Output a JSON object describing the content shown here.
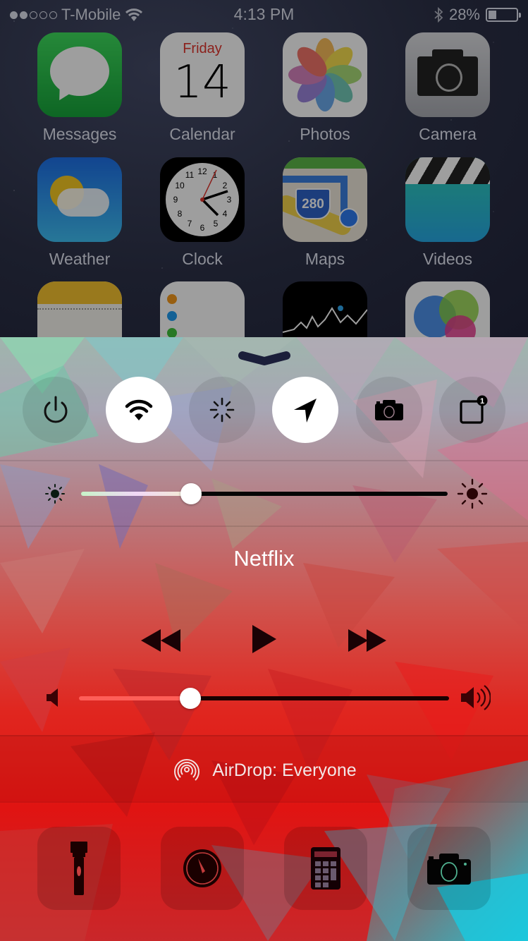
{
  "status_bar": {
    "signal_bars_filled": 2,
    "signal_bars_total": 5,
    "carrier": "T-Mobile",
    "time": "4:13 PM",
    "battery_percent_label": "28%",
    "battery_level": 0.28,
    "icons": [
      "wifi-icon",
      "bluetooth-icon",
      "battery-icon"
    ]
  },
  "home_screen": {
    "apps": [
      {
        "name": "Messages",
        "icon": "messages-icon"
      },
      {
        "name": "Calendar",
        "icon": "calendar-icon",
        "day": "Friday",
        "date": "14"
      },
      {
        "name": "Photos",
        "icon": "photos-icon"
      },
      {
        "name": "Camera",
        "icon": "camera-icon"
      },
      {
        "name": "Weather",
        "icon": "weather-icon"
      },
      {
        "name": "Clock",
        "icon": "clock-icon"
      },
      {
        "name": "Maps",
        "icon": "maps-icon",
        "route_sign": "280"
      },
      {
        "name": "Videos",
        "icon": "videos-icon"
      },
      {
        "name": "",
        "icon": "notes-icon"
      },
      {
        "name": "",
        "icon": "reminders-icon"
      },
      {
        "name": "",
        "icon": "stocks-icon"
      },
      {
        "name": "",
        "icon": "game-center-icon"
      }
    ]
  },
  "control_center": {
    "toggles": [
      {
        "name": "power-toggle",
        "icon": "power-icon",
        "on": false
      },
      {
        "name": "wifi-toggle",
        "icon": "wifi-icon",
        "on": true
      },
      {
        "name": "brightness-toggle",
        "icon": "loading-spinner-icon",
        "on": false
      },
      {
        "name": "location-toggle",
        "icon": "location-arrow-icon",
        "on": true
      },
      {
        "name": "camera-toggle",
        "icon": "camera-icon",
        "on": false
      },
      {
        "name": "notification-toggle",
        "icon": "notification-badge-icon",
        "on": false,
        "badge": "1"
      }
    ],
    "brightness": {
      "value": 0.3
    },
    "now_playing": {
      "title": "Netflix",
      "controls": [
        "rewind",
        "play",
        "fast-forward"
      ]
    },
    "volume": {
      "value": 0.3
    },
    "airdrop": {
      "label": "AirDrop: Everyone"
    },
    "shortcuts": [
      {
        "name": "flashlight",
        "icon": "flashlight-icon"
      },
      {
        "name": "timer",
        "icon": "timer-icon"
      },
      {
        "name": "calculator",
        "icon": "calculator-icon"
      },
      {
        "name": "camera",
        "icon": "camera-icon"
      }
    ]
  }
}
